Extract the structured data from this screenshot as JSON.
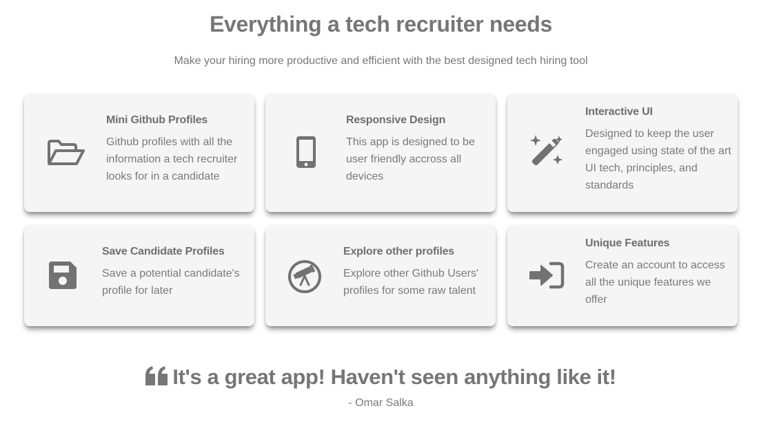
{
  "header": {
    "title": "Everything a tech recruiter needs",
    "subtitle": "Make your hiring more productive and efficient with the best designed tech hiring tool"
  },
  "features": [
    {
      "title": "Mini Github Profiles",
      "description": "Github profiles with all the information a tech recruiter looks for in a candidate",
      "icon": "folder-open-icon"
    },
    {
      "title": "Responsive Design",
      "description": "This app is designed to be user friendly accross all devices",
      "icon": "mobile-phone-icon"
    },
    {
      "title": "Interactive UI",
      "description": "Designed to keep the user engaged using state of the art UI tech, principles, and standards",
      "icon": "magic-wand-icon"
    },
    {
      "title": "Save Candidate Profiles",
      "description": "Save a potential candidate's profile for later",
      "icon": "floppy-disk-icon"
    },
    {
      "title": "Explore other profiles",
      "description": "Explore other Github Users' profiles for some raw talent",
      "icon": "telescope-icon"
    },
    {
      "title": "Unique Features",
      "description": "Create an account to access all the unique features we offer",
      "icon": "sign-in-icon"
    }
  ],
  "testimonial": {
    "quote": "It's a great app! Haven't seen anything like it!",
    "author": "- Omar Salka",
    "icon": "quote-left-icon"
  },
  "colors": {
    "text": "#767676",
    "card_background": "#f5f5f5",
    "icon": "#727272"
  }
}
